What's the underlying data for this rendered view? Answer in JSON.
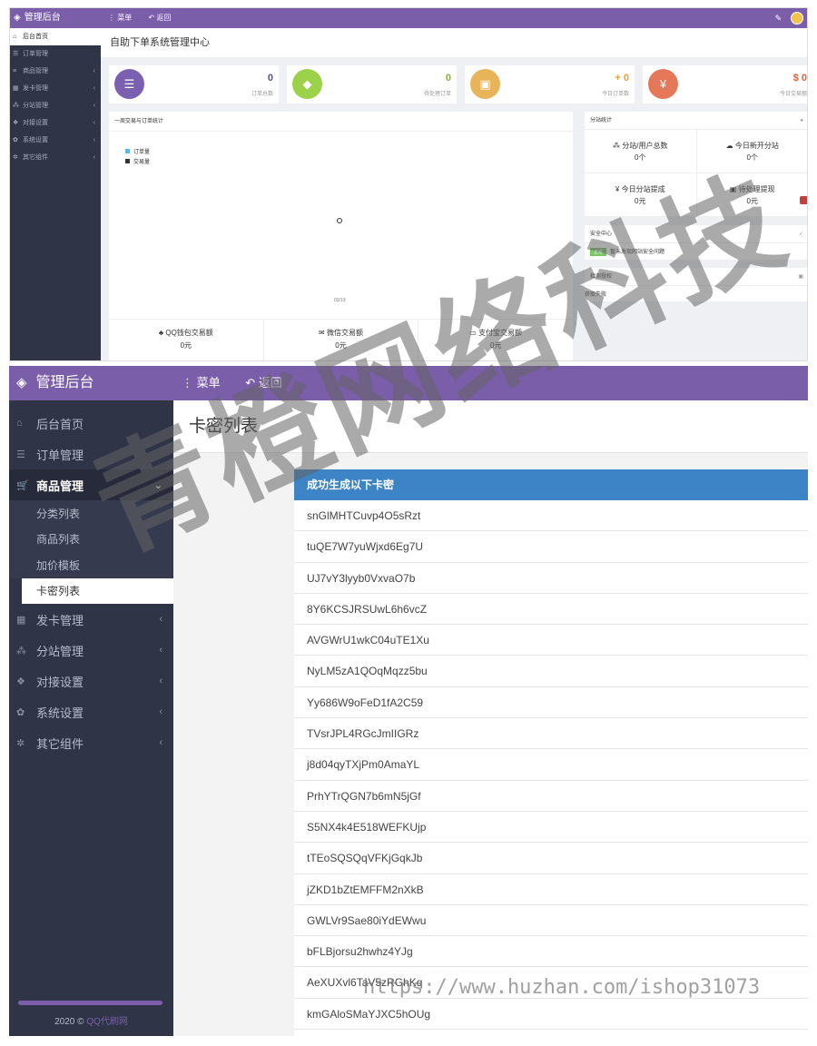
{
  "top": {
    "brand": "管理后台",
    "btn_menu": "菜单",
    "btn_back": "返回",
    "sidebar": [
      {
        "icon": "home-icon",
        "glyph": "⌂",
        "label": "后台首页",
        "active": true
      },
      {
        "icon": "list-icon",
        "glyph": "☰",
        "label": "订单管理"
      },
      {
        "icon": "cart-icon",
        "glyph": "≡",
        "label": "商品管理",
        "chev": true
      },
      {
        "icon": "grid-icon",
        "glyph": "▦",
        "label": "发卡管理",
        "chev": true
      },
      {
        "icon": "sitemap-icon",
        "glyph": "⁂",
        "label": "分站管理",
        "chev": true
      },
      {
        "icon": "cubes-icon",
        "glyph": "❖",
        "label": "对接设置",
        "chev": true
      },
      {
        "icon": "gear-icon",
        "glyph": "✿",
        "label": "系统设置",
        "chev": true
      },
      {
        "icon": "gears-icon",
        "glyph": "✲",
        "label": "其它组件",
        "chev": true
      }
    ],
    "title": "自助下单系统管理中心",
    "stats": [
      {
        "value": "0",
        "label": "订单总数",
        "color": "#7b5fb0",
        "icon": "list-icon",
        "glyph": "☰",
        "value_color": "#5b4896"
      },
      {
        "value": "0",
        "label": "待处理订单",
        "color": "#9bd24a",
        "icon": "cube-icon",
        "glyph": "◆",
        "value_color": "#7cba31"
      },
      {
        "value": "+ 0",
        "label": "今日订单数",
        "color": "#e8b45a",
        "icon": "briefcase-icon",
        "glyph": "▣",
        "value_color": "#e0a53d"
      },
      {
        "value": "$ 0",
        "label": "今日交易额",
        "color": "#e57859",
        "icon": "yen-icon",
        "glyph": "¥",
        "value_color": "#e0603d"
      }
    ],
    "chart_panel": {
      "title": "一周交易与订单统计",
      "legend": [
        {
          "name": "订单量",
          "color": "#5fb9e6"
        },
        {
          "name": "交易量",
          "color": "#333333"
        }
      ],
      "x_tick": "03/13",
      "footer": [
        {
          "icon": "qq-icon",
          "glyph": "♣",
          "label": "QQ钱包交易额",
          "value": "0元"
        },
        {
          "icon": "wechat-icon",
          "glyph": "✉",
          "label": "微信交易额",
          "value": "0元"
        },
        {
          "icon": "card-icon",
          "glyph": "▭",
          "label": "支付宝交易额",
          "value": "0元"
        }
      ]
    },
    "chart_data": {
      "type": "line",
      "title": "一周交易与订单统计",
      "categories": [
        "03/13"
      ],
      "series": [
        {
          "name": "订单量",
          "values": [
            0
          ]
        },
        {
          "name": "交易量",
          "values": [
            0
          ]
        }
      ]
    },
    "site_panel": {
      "title": "分站统计",
      "cells": [
        {
          "icon": "sitemap-icon",
          "glyph": "⁂",
          "label": "分站/用户总数",
          "value": "0个"
        },
        {
          "icon": "cloud-icon",
          "glyph": "☁",
          "label": "今日新开分站",
          "value": "0个"
        },
        {
          "icon": "yen-icon",
          "glyph": "¥",
          "label": "今日分站提成",
          "value": "0元"
        },
        {
          "icon": "cash-icon",
          "glyph": "▣",
          "label": "待处理提现",
          "value": "0元"
        }
      ]
    },
    "security_panel": {
      "title": "安全中心",
      "tag": "正常",
      "text": "暂未发现网站安全问题"
    },
    "detect_panel": {
      "title": "检测授权",
      "text": "获取失败"
    }
  },
  "main": {
    "brand": "管理后台",
    "btn_menu": "菜单",
    "btn_back": "返回",
    "sidebar": [
      {
        "icon": "home-icon",
        "glyph": "⌂",
        "label": "后台首页"
      },
      {
        "icon": "list-icon",
        "glyph": "☰",
        "label": "订单管理"
      }
    ],
    "open_group": {
      "icon": "cart-icon",
      "glyph": "🛒",
      "label": "商品管理",
      "chev": "⌄"
    },
    "submenu": [
      {
        "label": "分类列表"
      },
      {
        "label": "商品列表"
      },
      {
        "label": "加价模板"
      },
      {
        "label": "卡密列表",
        "active": true
      }
    ],
    "sidebar_after": [
      {
        "icon": "grid-icon",
        "glyph": "▦",
        "label": "发卡管理"
      },
      {
        "icon": "sitemap-icon",
        "glyph": "⁂",
        "label": "分站管理"
      },
      {
        "icon": "cubes-icon",
        "glyph": "❖",
        "label": "对接设置"
      },
      {
        "icon": "gear-icon",
        "glyph": "✿",
        "label": "系统设置"
      },
      {
        "icon": "gears-icon",
        "glyph": "✲",
        "label": "其它组件"
      }
    ],
    "footer_text": "2020 ©",
    "footer_link": "QQ代刷网",
    "page_title": "卡密列表",
    "panel_title": "成功生成以下卡密",
    "cards": [
      "snGlMHTCuvp4O5sRzt",
      "tuQE7W7yuWjxd6Eg7U",
      "UJ7vY3lyyb0VxvaO7b",
      "8Y6KCSJRSUwL6h6vcZ",
      "AVGWrU1wkC04uTE1Xu",
      "NyLM5zA1QOqMqzz5bu",
      "Yy686W9oFeD1fA2C59",
      "TVsrJPL4RGcJmIIGRz",
      "j8d04qyTXjPm0AmaYL",
      "PrhYTrQGN7b6mN5jGf",
      "S5NX4k4E518WEFKUjp",
      "tTEoSQSQqVFKjGqkJb",
      "jZKD1bZtEMFFM2nXkB",
      "GWLVr9Sae80iYdEWwu",
      "bFLBjorsu2hwhz4YJg",
      "AeXUXvl6TaV5zRGhKq",
      "kmGAloSMaYJXC5hOUg"
    ]
  },
  "watermark": {
    "text": "青橙网络科技",
    "url": "https://www.huzhan.com/ishop31073"
  }
}
